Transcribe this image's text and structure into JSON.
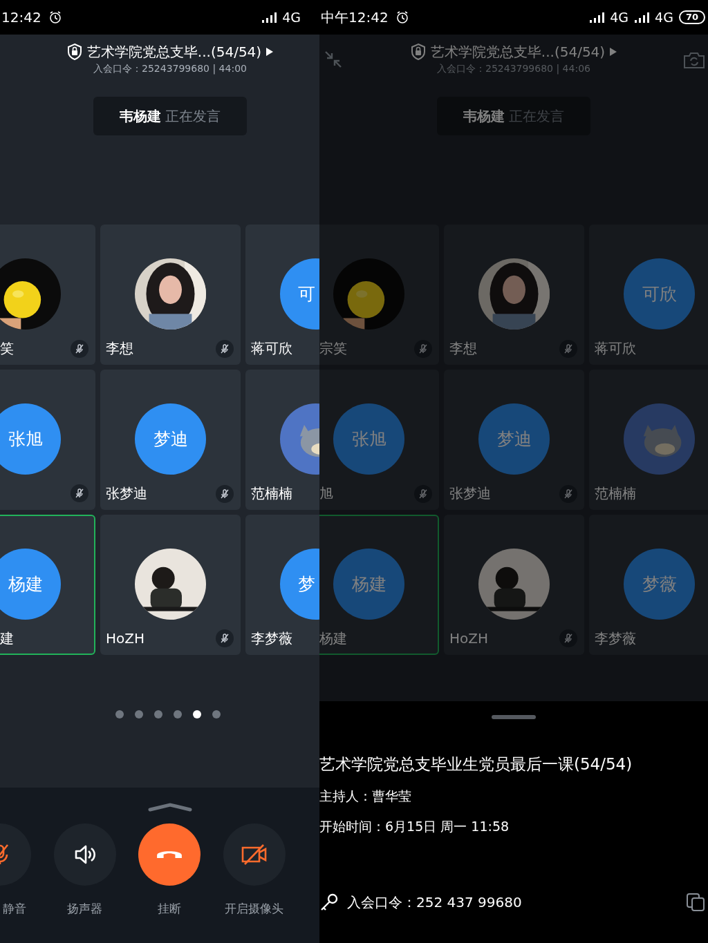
{
  "panels": [
    {
      "kind": "cropped",
      "dimmed": false,
      "status_bar": {
        "time": "12:42",
        "networks": [
          "4G"
        ]
      },
      "meeting": {
        "title": "艺术学院党总支毕...(54/54)",
        "subtitle": "入会口令：25243799680 | 44:00"
      },
      "speaker": {
        "name": "韦杨建",
        "status": "正在发言"
      },
      "participants": [
        {
          "name": "笑",
          "muted": true,
          "speaking": false
        },
        {
          "name": "李想",
          "muted": true,
          "speaking": false
        },
        {
          "name": "蒋可欣",
          "avatar": {
            "kind": "text",
            "text": "可"
          },
          "speaking": false
        },
        {
          "avatar": {
            "kind": "text",
            "text": "张旭"
          },
          "muted": true,
          "speaking": false
        },
        {
          "name": "张梦迪",
          "avatar": {
            "kind": "text",
            "text": "梦迪"
          },
          "muted": true,
          "speaking": false
        },
        {
          "name": "范楠楠",
          "speaking": false
        },
        {
          "name": "建",
          "avatar": {
            "kind": "text",
            "text": "杨建"
          },
          "muted": false,
          "speaking": true
        },
        {
          "name": "HoZH",
          "muted": true,
          "speaking": false
        },
        {
          "name": "李梦薇",
          "avatar": {
            "kind": "text",
            "text": "梦"
          },
          "speaking": false
        }
      ],
      "page_dots": [
        {
          "selected": false
        },
        {
          "selected": false
        },
        {
          "selected": false
        },
        {
          "selected": false
        },
        {
          "selected": true
        },
        {
          "selected": false
        }
      ],
      "controls": [
        {
          "kind": "mute",
          "label": "静音"
        },
        {
          "kind": "speaker",
          "label": "扬声器"
        },
        {
          "kind": "hangup",
          "label": "挂断"
        },
        {
          "kind": "camera",
          "label": "开启摄像头"
        }
      ]
    },
    {
      "kind": "full",
      "dimmed": true,
      "status_bar": {
        "time": "中午12:42",
        "networks": [
          "4G",
          "4G"
        ],
        "battery": "70"
      },
      "meeting": {
        "title": "艺术学院党总支毕...(54/54)",
        "subtitle": "入会口令：25243799680 | 44:06"
      },
      "speaker": {
        "name": "韦杨建",
        "status": "正在发言"
      },
      "participants": [
        {
          "name": "宗笑",
          "muted": true,
          "speaking": false
        },
        {
          "name": "李想",
          "muted": true,
          "speaking": false
        },
        {
          "name": "蒋可欣",
          "avatar": {
            "kind": "text",
            "text": "可欣"
          },
          "speaking": false
        },
        {
          "name": "旭",
          "avatar": {
            "kind": "text",
            "text": "张旭"
          },
          "muted": true,
          "speaking": false
        },
        {
          "name": "张梦迪",
          "avatar": {
            "kind": "text",
            "text": "梦迪"
          },
          "muted": true,
          "speaking": false
        },
        {
          "name": "范楠楠",
          "speaking": false
        },
        {
          "name": "杨建",
          "avatar": {
            "kind": "text",
            "text": "杨建"
          },
          "muted": false,
          "speaking": true
        },
        {
          "name": "HoZH",
          "muted": true,
          "speaking": false
        },
        {
          "name": "李梦薇",
          "avatar": {
            "kind": "text",
            "text": "梦薇"
          },
          "speaking": false
        }
      ],
      "info_sheet": {
        "title": "艺术学院党总支毕业生党员最后一课(54/54)",
        "host": "主持人：曹华莹",
        "start_time": "开始时间：6月15日 周一 11:58",
        "passcode": "入会口令：252 437 99680"
      }
    }
  ]
}
